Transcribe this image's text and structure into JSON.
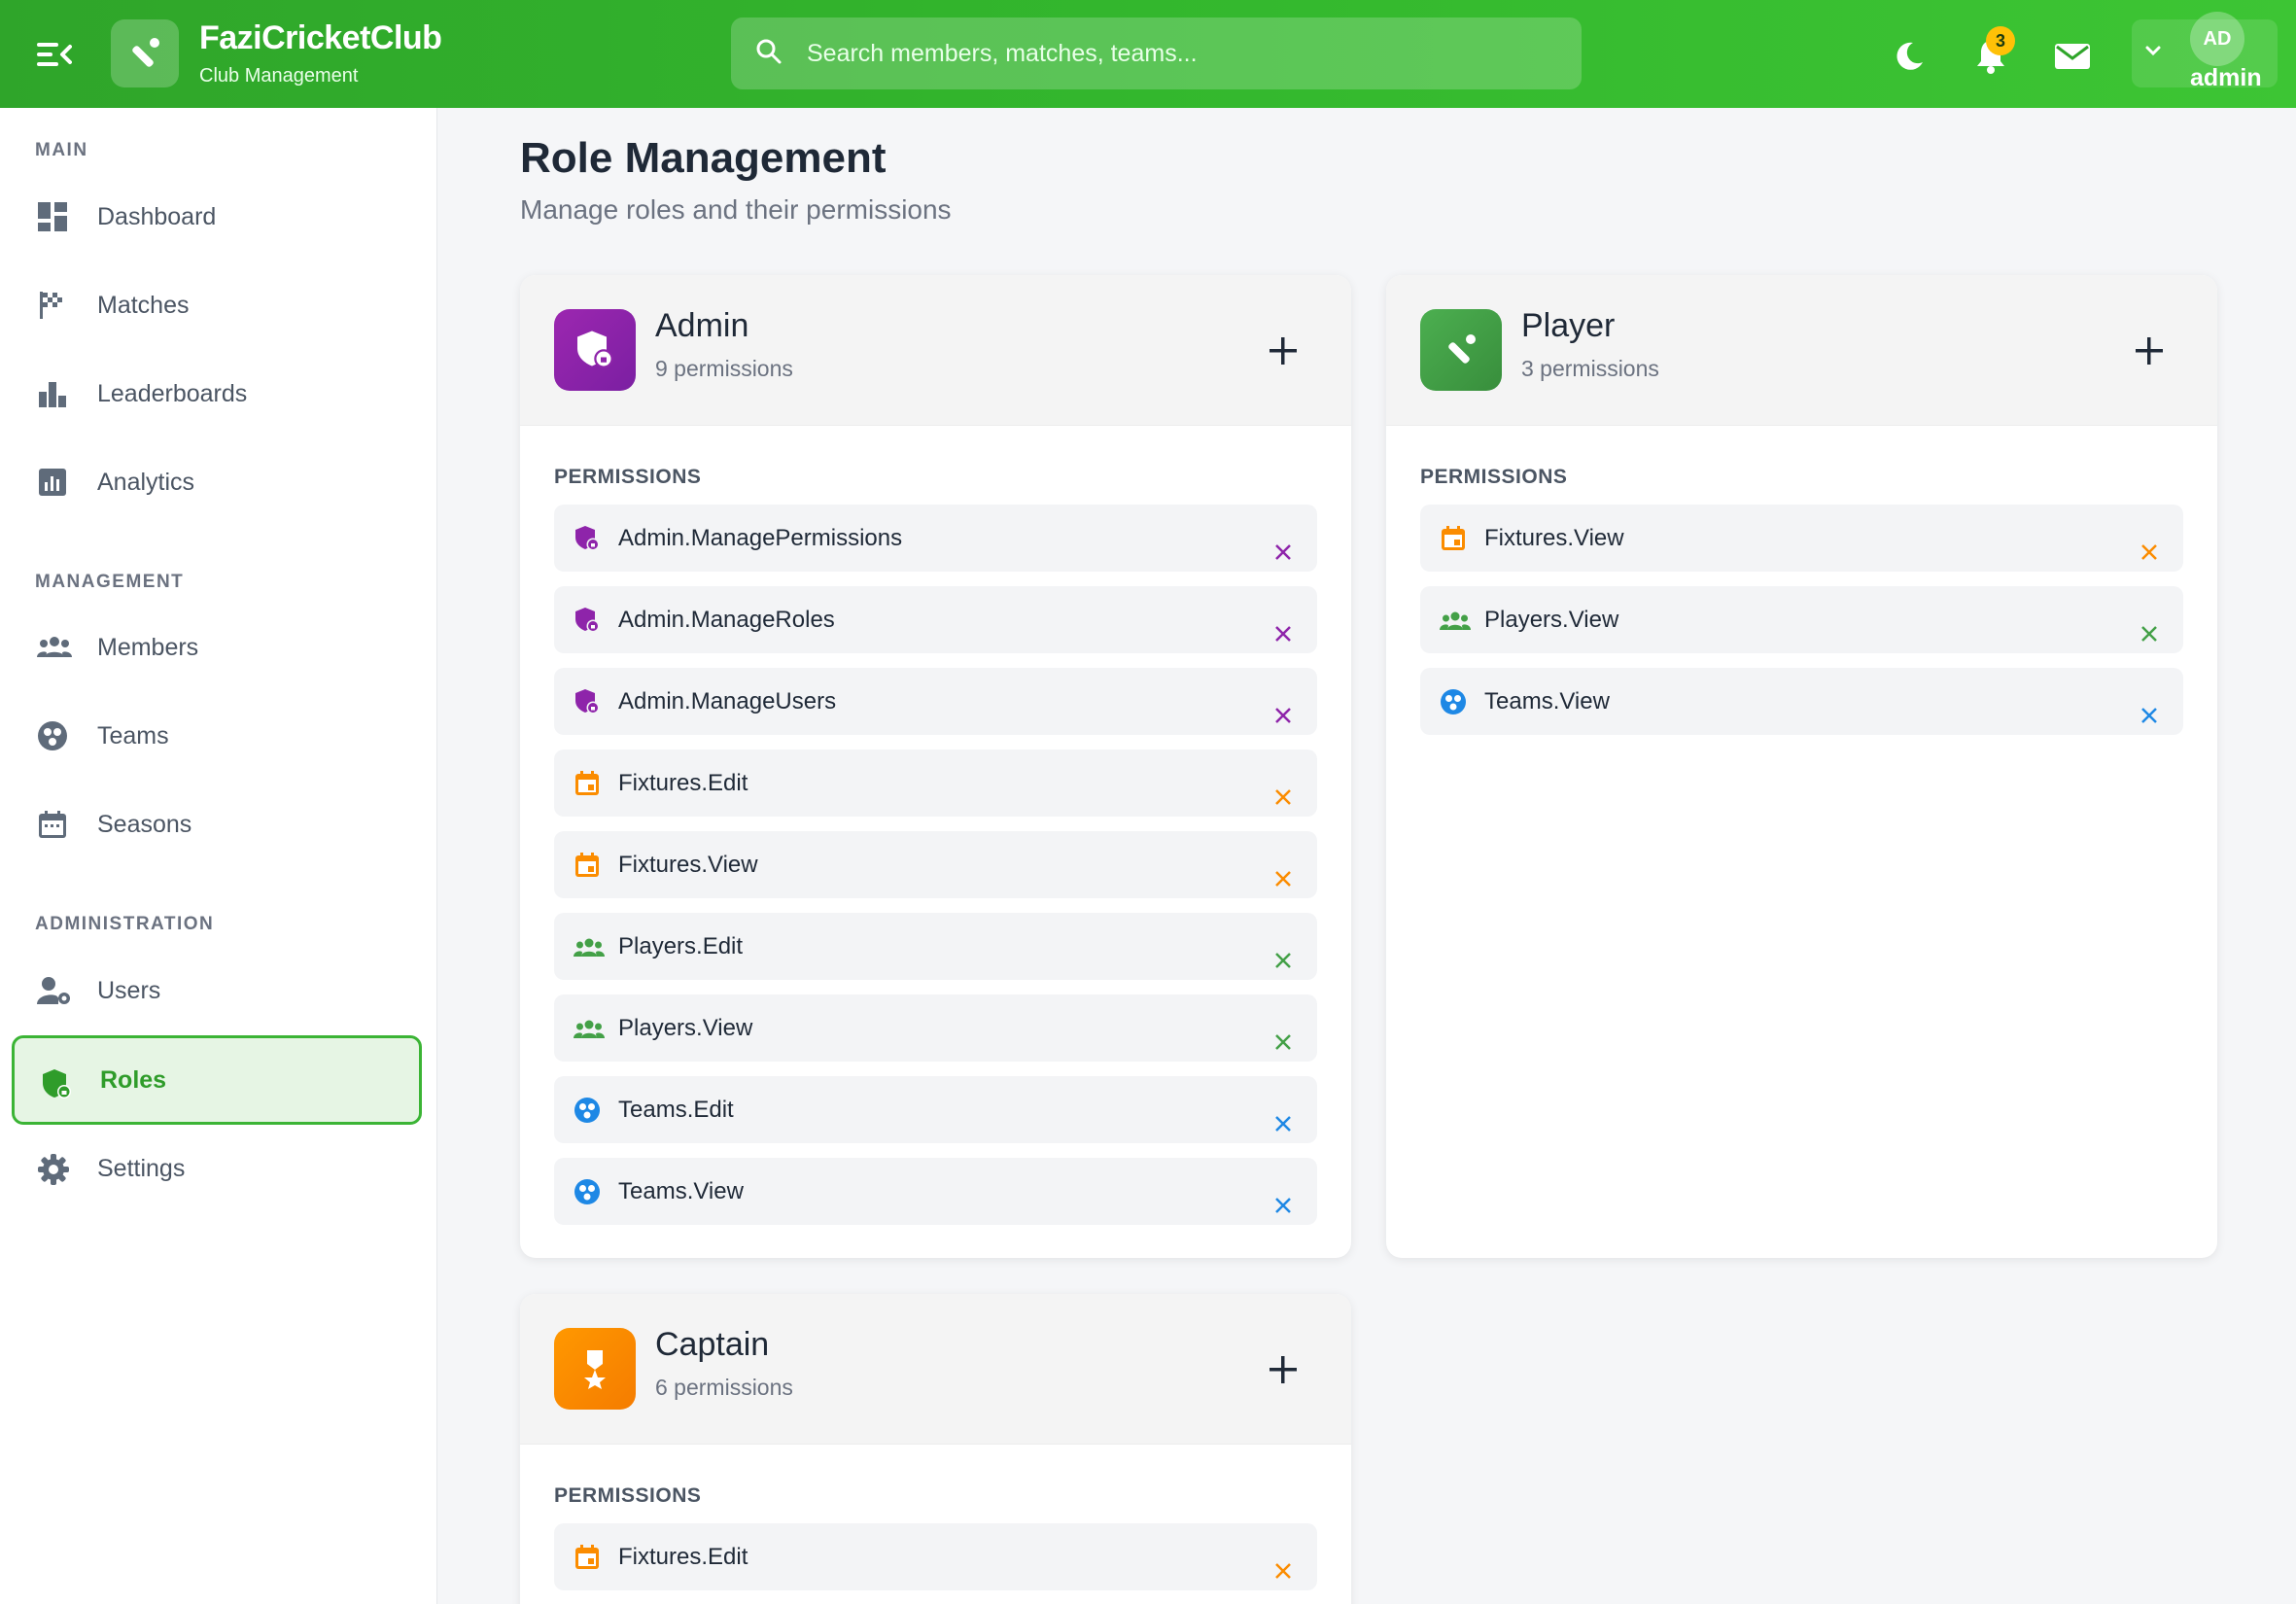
{
  "app": {
    "name": "FaziCricketClub",
    "subtitle": "Club Management"
  },
  "search": {
    "placeholder": "Search members, matches, teams..."
  },
  "header": {
    "notification_count": "3",
    "user_initials": "AD",
    "user_name": "admin"
  },
  "sidebar": {
    "sections": {
      "main": "MAIN",
      "management": "MANAGEMENT",
      "administration": "ADMINISTRATION"
    },
    "items": {
      "dashboard": "Dashboard",
      "matches": "Matches",
      "leaderboards": "Leaderboards",
      "analytics": "Analytics",
      "members": "Members",
      "teams": "Teams",
      "seasons": "Seasons",
      "users": "Users",
      "roles": "Roles",
      "settings": "Settings"
    },
    "active": "roles"
  },
  "page": {
    "title": "Role Management",
    "subtitle": "Manage roles and their permissions"
  },
  "roles": {
    "permissions_label": "PERMISSIONS",
    "admin": {
      "name": "Admin",
      "count": "9 permissions",
      "color": "#8e24aa",
      "permissions": [
        "Admin.ManagePermissions",
        "Admin.ManageRoles",
        "Admin.ManageUsers",
        "Fixtures.Edit",
        "Fixtures.View",
        "Players.Edit",
        "Players.View",
        "Teams.Edit",
        "Teams.View"
      ]
    },
    "player": {
      "name": "Player",
      "count": "3 permissions",
      "color": "#43a047",
      "permissions": [
        "Fixtures.View",
        "Players.View",
        "Teams.View"
      ]
    },
    "captain": {
      "name": "Captain",
      "count": "6 permissions",
      "color": "#fb8c00",
      "permissions": [
        "Fixtures.Edit"
      ]
    }
  },
  "colors": {
    "admin": "#8e24aa",
    "fixtures": "#fb8c00",
    "players": "#43a047",
    "teams": "#1e88e5",
    "brand": "#33b72d"
  }
}
